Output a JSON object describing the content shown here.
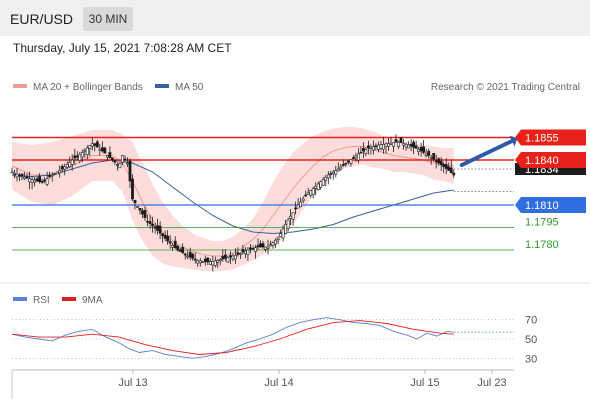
{
  "header": {
    "symbol": "EUR/USD",
    "interval": "30 MIN"
  },
  "datetime": "Thursday, July 15, 2021 7:08:28 AM CET",
  "colors": {
    "header_bg": "#f0f0f0",
    "resistance": "#e8211b",
    "support_blue": "#2f6fe0",
    "support_green": "#2a9d2a",
    "candle": "#1c1c1c",
    "bollinger_fill": "#fbd2d0",
    "ma20": "#f29a94",
    "ma50": "#3a5fa0",
    "rsi": "#5b82d6",
    "rsi_ma": "#e02020",
    "arrow": "#2a5aa8"
  },
  "chart_data": [
    {
      "type": "candlestick",
      "title": "EUR/USD",
      "legend": [
        "MA 20 + Bollinger Bands",
        "MA 50"
      ],
      "legend_placement": "top-left",
      "credit": "Research © 2021 Trading Central",
      "current_price": 1.1834,
      "current_price_label": "1.1834",
      "ylim": [
        1.176,
        1.188
      ],
      "levels": [
        {
          "label": "1.1855",
          "value": 1.1855,
          "kind": "resistance",
          "style": "box-red"
        },
        {
          "label": "1.1840",
          "value": 1.184,
          "kind": "pivot",
          "style": "box-red"
        },
        {
          "label": "1.1810",
          "value": 1.181,
          "kind": "support",
          "style": "box-blue"
        },
        {
          "label": "1.1795",
          "value": 1.1795,
          "kind": "support",
          "style": "green-text"
        },
        {
          "label": "1.1780",
          "value": 1.178,
          "kind": "support",
          "style": "green-text"
        }
      ],
      "price_path": [
        [
          0,
          1.1832
        ],
        [
          6,
          1.1829
        ],
        [
          12,
          1.1827
        ],
        [
          18,
          1.1825
        ],
        [
          24,
          1.183
        ],
        [
          30,
          1.1834
        ],
        [
          36,
          1.184
        ],
        [
          42,
          1.1845
        ],
        [
          48,
          1.1851
        ],
        [
          54,
          1.1846
        ],
        [
          60,
          1.184
        ],
        [
          64,
          1.1836
        ],
        [
          66,
          1.1843
        ],
        [
          69,
          1.1838
        ],
        [
          72,
          1.1814
        ],
        [
          75,
          1.1809
        ],
        [
          81,
          1.1799
        ],
        [
          87,
          1.1793
        ],
        [
          93,
          1.1786
        ],
        [
          99,
          1.178
        ],
        [
          105,
          1.1776
        ],
        [
          111,
          1.1773
        ],
        [
          117,
          1.1772
        ],
        [
          123,
          1.1773
        ],
        [
          129,
          1.1775
        ],
        [
          135,
          1.1777
        ],
        [
          141,
          1.178
        ],
        [
          147,
          1.1782
        ],
        [
          153,
          1.1782
        ],
        [
          159,
          1.1788
        ],
        [
          165,
          1.18
        ],
        [
          171,
          1.181
        ],
        [
          177,
          1.1818
        ],
        [
          183,
          1.1824
        ],
        [
          189,
          1.183
        ],
        [
          195,
          1.1834
        ],
        [
          201,
          1.1839
        ],
        [
          207,
          1.1844
        ],
        [
          213,
          1.1848
        ],
        [
          219,
          1.185
        ],
        [
          225,
          1.1851
        ],
        [
          231,
          1.1852
        ],
        [
          237,
          1.185
        ],
        [
          243,
          1.1847
        ],
        [
          249,
          1.1843
        ],
        [
          255,
          1.1838
        ],
        [
          261,
          1.1833
        ],
        [
          264,
          1.183
        ]
      ],
      "ma20_path": [
        [
          0,
          1.1836
        ],
        [
          12,
          1.183
        ],
        [
          24,
          1.183
        ],
        [
          36,
          1.1836
        ],
        [
          48,
          1.1843
        ],
        [
          60,
          1.1843
        ],
        [
          66,
          1.1838
        ],
        [
          72,
          1.1826
        ],
        [
          78,
          1.1812
        ],
        [
          84,
          1.18
        ],
        [
          90,
          1.1792
        ],
        [
          96,
          1.1786
        ],
        [
          102,
          1.1782
        ],
        [
          108,
          1.1779
        ],
        [
          114,
          1.1777
        ],
        [
          120,
          1.1776
        ],
        [
          126,
          1.1776
        ],
        [
          132,
          1.1778
        ],
        [
          138,
          1.1782
        ],
        [
          144,
          1.1787
        ],
        [
          150,
          1.1794
        ],
        [
          156,
          1.1803
        ],
        [
          162,
          1.1812
        ],
        [
          168,
          1.1821
        ],
        [
          174,
          1.1829
        ],
        [
          180,
          1.1836
        ],
        [
          186,
          1.1842
        ],
        [
          192,
          1.1846
        ],
        [
          198,
          1.1848
        ],
        [
          204,
          1.1849
        ],
        [
          210,
          1.1849
        ],
        [
          216,
          1.1847
        ],
        [
          222,
          1.1845
        ],
        [
          228,
          1.1843
        ],
        [
          234,
          1.1842
        ],
        [
          240,
          1.1841
        ],
        [
          246,
          1.184
        ],
        [
          252,
          1.1838
        ],
        [
          258,
          1.1837
        ],
        [
          264,
          1.1836
        ]
      ],
      "bollinger_upper": [
        [
          0,
          1.1852
        ],
        [
          12,
          1.185
        ],
        [
          24,
          1.1852
        ],
        [
          36,
          1.1856
        ],
        [
          48,
          1.186
        ],
        [
          60,
          1.186
        ],
        [
          66,
          1.1857
        ],
        [
          72,
          1.1852
        ],
        [
          78,
          1.1838
        ],
        [
          84,
          1.1824
        ],
        [
          90,
          1.1812
        ],
        [
          96,
          1.1803
        ],
        [
          102,
          1.1796
        ],
        [
          108,
          1.1791
        ],
        [
          114,
          1.1788
        ],
        [
          120,
          1.1786
        ],
        [
          126,
          1.1786
        ],
        [
          132,
          1.1789
        ],
        [
          138,
          1.1794
        ],
        [
          144,
          1.1801
        ],
        [
          150,
          1.1812
        ],
        [
          156,
          1.1825
        ],
        [
          162,
          1.1836
        ],
        [
          168,
          1.1845
        ],
        [
          174,
          1.1851
        ],
        [
          180,
          1.1856
        ],
        [
          186,
          1.1859
        ],
        [
          192,
          1.1861
        ],
        [
          198,
          1.1862
        ],
        [
          204,
          1.1862
        ],
        [
          210,
          1.1861
        ],
        [
          216,
          1.1859
        ],
        [
          222,
          1.1856
        ],
        [
          228,
          1.1854
        ],
        [
          234,
          1.1852
        ],
        [
          240,
          1.1851
        ],
        [
          246,
          1.185
        ],
        [
          252,
          1.1849
        ],
        [
          258,
          1.1848
        ],
        [
          264,
          1.1848
        ]
      ],
      "bollinger_lower": [
        [
          0,
          1.182
        ],
        [
          12,
          1.1812
        ],
        [
          24,
          1.181
        ],
        [
          36,
          1.1816
        ],
        [
          48,
          1.1826
        ],
        [
          60,
          1.1826
        ],
        [
          66,
          1.1819
        ],
        [
          72,
          1.18
        ],
        [
          78,
          1.1786
        ],
        [
          84,
          1.1776
        ],
        [
          90,
          1.1771
        ],
        [
          96,
          1.1769
        ],
        [
          102,
          1.1768
        ],
        [
          108,
          1.1767
        ],
        [
          114,
          1.1766
        ],
        [
          120,
          1.1766
        ],
        [
          126,
          1.1766
        ],
        [
          132,
          1.1767
        ],
        [
          138,
          1.177
        ],
        [
          144,
          1.1773
        ],
        [
          150,
          1.1777
        ],
        [
          156,
          1.1781
        ],
        [
          162,
          1.1788
        ],
        [
          168,
          1.1797
        ],
        [
          174,
          1.1807
        ],
        [
          180,
          1.1816
        ],
        [
          186,
          1.1825
        ],
        [
          192,
          1.1831
        ],
        [
          198,
          1.1834
        ],
        [
          204,
          1.1836
        ],
        [
          210,
          1.1837
        ],
        [
          216,
          1.1835
        ],
        [
          222,
          1.1834
        ],
        [
          228,
          1.1832
        ],
        [
          234,
          1.1832
        ],
        [
          240,
          1.1831
        ],
        [
          246,
          1.183
        ],
        [
          252,
          1.1827
        ],
        [
          258,
          1.1826
        ],
        [
          264,
          1.1824
        ]
      ],
      "ma50_path": [
        [
          0,
          1.183
        ],
        [
          12,
          1.1829
        ],
        [
          24,
          1.183
        ],
        [
          36,
          1.1834
        ],
        [
          48,
          1.1838
        ],
        [
          60,
          1.184
        ],
        [
          72,
          1.1838
        ],
        [
          84,
          1.1832
        ],
        [
          96,
          1.1822
        ],
        [
          108,
          1.1812
        ],
        [
          120,
          1.1803
        ],
        [
          132,
          1.1796
        ],
        [
          144,
          1.1792
        ],
        [
          156,
          1.1791
        ],
        [
          168,
          1.1792
        ],
        [
          180,
          1.1794
        ],
        [
          192,
          1.1797
        ],
        [
          204,
          1.1802
        ],
        [
          216,
          1.1806
        ],
        [
          228,
          1.181
        ],
        [
          240,
          1.1814
        ],
        [
          252,
          1.1818
        ],
        [
          264,
          1.182
        ]
      ],
      "projection": {
        "from": [
          264,
          1.1834
        ],
        "to": [
          300,
          1.1854
        ]
      }
    },
    {
      "type": "line",
      "title": "",
      "legend": [
        "RSI",
        "9MA"
      ],
      "legend_placement": "top-left",
      "ylim": [
        20,
        80
      ],
      "yticks": [
        30,
        50,
        70
      ],
      "grid_levels": [
        30,
        50,
        70
      ],
      "x_labels": [
        "Jul 13",
        "Jul 14",
        "Jul 15",
        "Jul 23"
      ],
      "rsi": [
        [
          0,
          55
        ],
        [
          8,
          52
        ],
        [
          16,
          50
        ],
        [
          24,
          48
        ],
        [
          32,
          54
        ],
        [
          40,
          58
        ],
        [
          48,
          60
        ],
        [
          56,
          52
        ],
        [
          64,
          46
        ],
        [
          70,
          40
        ],
        [
          76,
          36
        ],
        [
          84,
          38
        ],
        [
          92,
          34
        ],
        [
          100,
          32
        ],
        [
          108,
          30
        ],
        [
          116,
          32
        ],
        [
          124,
          35
        ],
        [
          132,
          40
        ],
        [
          140,
          46
        ],
        [
          148,
          50
        ],
        [
          156,
          55
        ],
        [
          164,
          62
        ],
        [
          172,
          67
        ],
        [
          180,
          70
        ],
        [
          188,
          72
        ],
        [
          196,
          70
        ],
        [
          204,
          67
        ],
        [
          212,
          66
        ],
        [
          220,
          64
        ],
        [
          228,
          58
        ],
        [
          236,
          54
        ],
        [
          242,
          50
        ],
        [
          248,
          56
        ],
        [
          254,
          53
        ],
        [
          260,
          58
        ],
        [
          264,
          57
        ]
      ],
      "rsi_ma": [
        [
          0,
          55
        ],
        [
          16,
          52
        ],
        [
          32,
          52
        ],
        [
          48,
          55
        ],
        [
          64,
          52
        ],
        [
          80,
          44
        ],
        [
          96,
          38
        ],
        [
          112,
          34
        ],
        [
          128,
          36
        ],
        [
          144,
          42
        ],
        [
          160,
          50
        ],
        [
          176,
          60
        ],
        [
          192,
          67
        ],
        [
          208,
          69
        ],
        [
          224,
          66
        ],
        [
          240,
          60
        ],
        [
          256,
          56
        ],
        [
          264,
          55
        ]
      ],
      "rsi_current": 57
    }
  ]
}
